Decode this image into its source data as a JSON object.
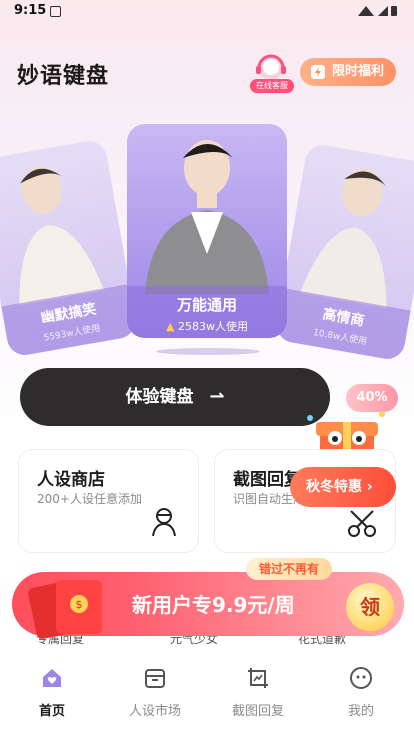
{
  "status": {
    "time": "9:15"
  },
  "header": {
    "app_title": "妙语键盘",
    "service_label": "在线客服",
    "limited_label": "限时福利"
  },
  "cards": [
    {
      "name": "幽默搞笑",
      "users": "5593w人使用"
    },
    {
      "name": "万能通用",
      "users": "2583w人使用"
    },
    {
      "name": "高情商",
      "users": "10.8w人使用"
    }
  ],
  "try_button": {
    "label": "体验键盘"
  },
  "discount_badge": "40%",
  "features": [
    {
      "title": "人设商店",
      "desc": "200+人设任意添加"
    },
    {
      "title": "截图回复",
      "desc": "识图自动生成回复"
    }
  ],
  "autumn_promo": {
    "label": "秋冬特惠"
  },
  "strip_items": [
    "专属回复",
    "元气少女",
    "花式道歉"
  ],
  "promo": {
    "tag": "错过不再有",
    "text": "新用户专9.9元/周",
    "claim": "领"
  },
  "tabs": [
    {
      "label": "首页",
      "active": true
    },
    {
      "label": "人设市场",
      "active": false
    },
    {
      "label": "截图回复",
      "active": false
    },
    {
      "label": "我的",
      "active": false
    }
  ],
  "colors": {
    "accent": "#9c86e6",
    "promo": "#ff4e5c",
    "dark_button": "#2e2c2c"
  }
}
